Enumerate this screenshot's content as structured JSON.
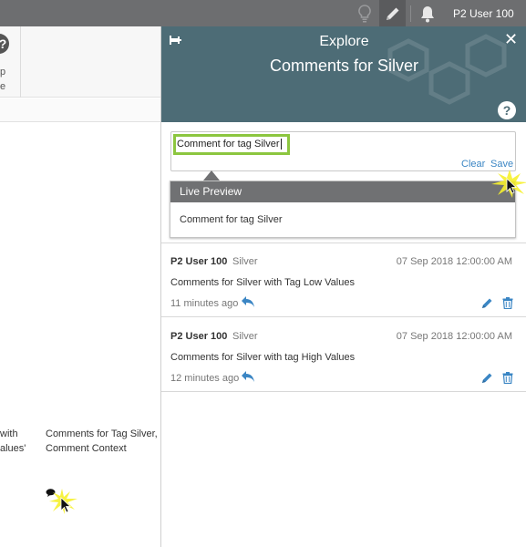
{
  "topbar": {
    "user": "P2 User 100",
    "icons": [
      "lightbulb-icon",
      "pencil-icon",
      "bell-icon"
    ]
  },
  "background": {
    "toolbar_label_line1": "p",
    "toolbar_label_line2": "e",
    "cell1_line1": "with",
    "cell1_line2": "alues'",
    "cell2_line1": "Comments for Tag Silver,",
    "cell2_line2": "Comment Context"
  },
  "panel": {
    "eyebrow": "Explore",
    "title": "Comments for Silver",
    "help_label": "?",
    "editor": {
      "value": "Comment for tag Silver",
      "clear_label": "Clear",
      "save_label": "Save"
    },
    "preview": {
      "header": "Live Preview",
      "body": "Comment for tag Silver"
    },
    "comments": [
      {
        "author": "P2 User 100",
        "tag": "Silver",
        "date": "07 Sep 2018 12:00:00 AM",
        "text": "Comments for Silver with Tag Low Values",
        "ago": "11 minutes ago"
      },
      {
        "author": "P2 User 100",
        "tag": "Silver",
        "date": "07 Sep 2018 12:00:00 AM",
        "text": "Comments for Silver with tag High Values",
        "ago": "12 minutes ago"
      }
    ]
  },
  "colors": {
    "header_bg": "#4d6c76",
    "topbar_bg": "#6d6e70",
    "link_blue": "#3b86c4",
    "input_focus": "#8cc63f"
  }
}
